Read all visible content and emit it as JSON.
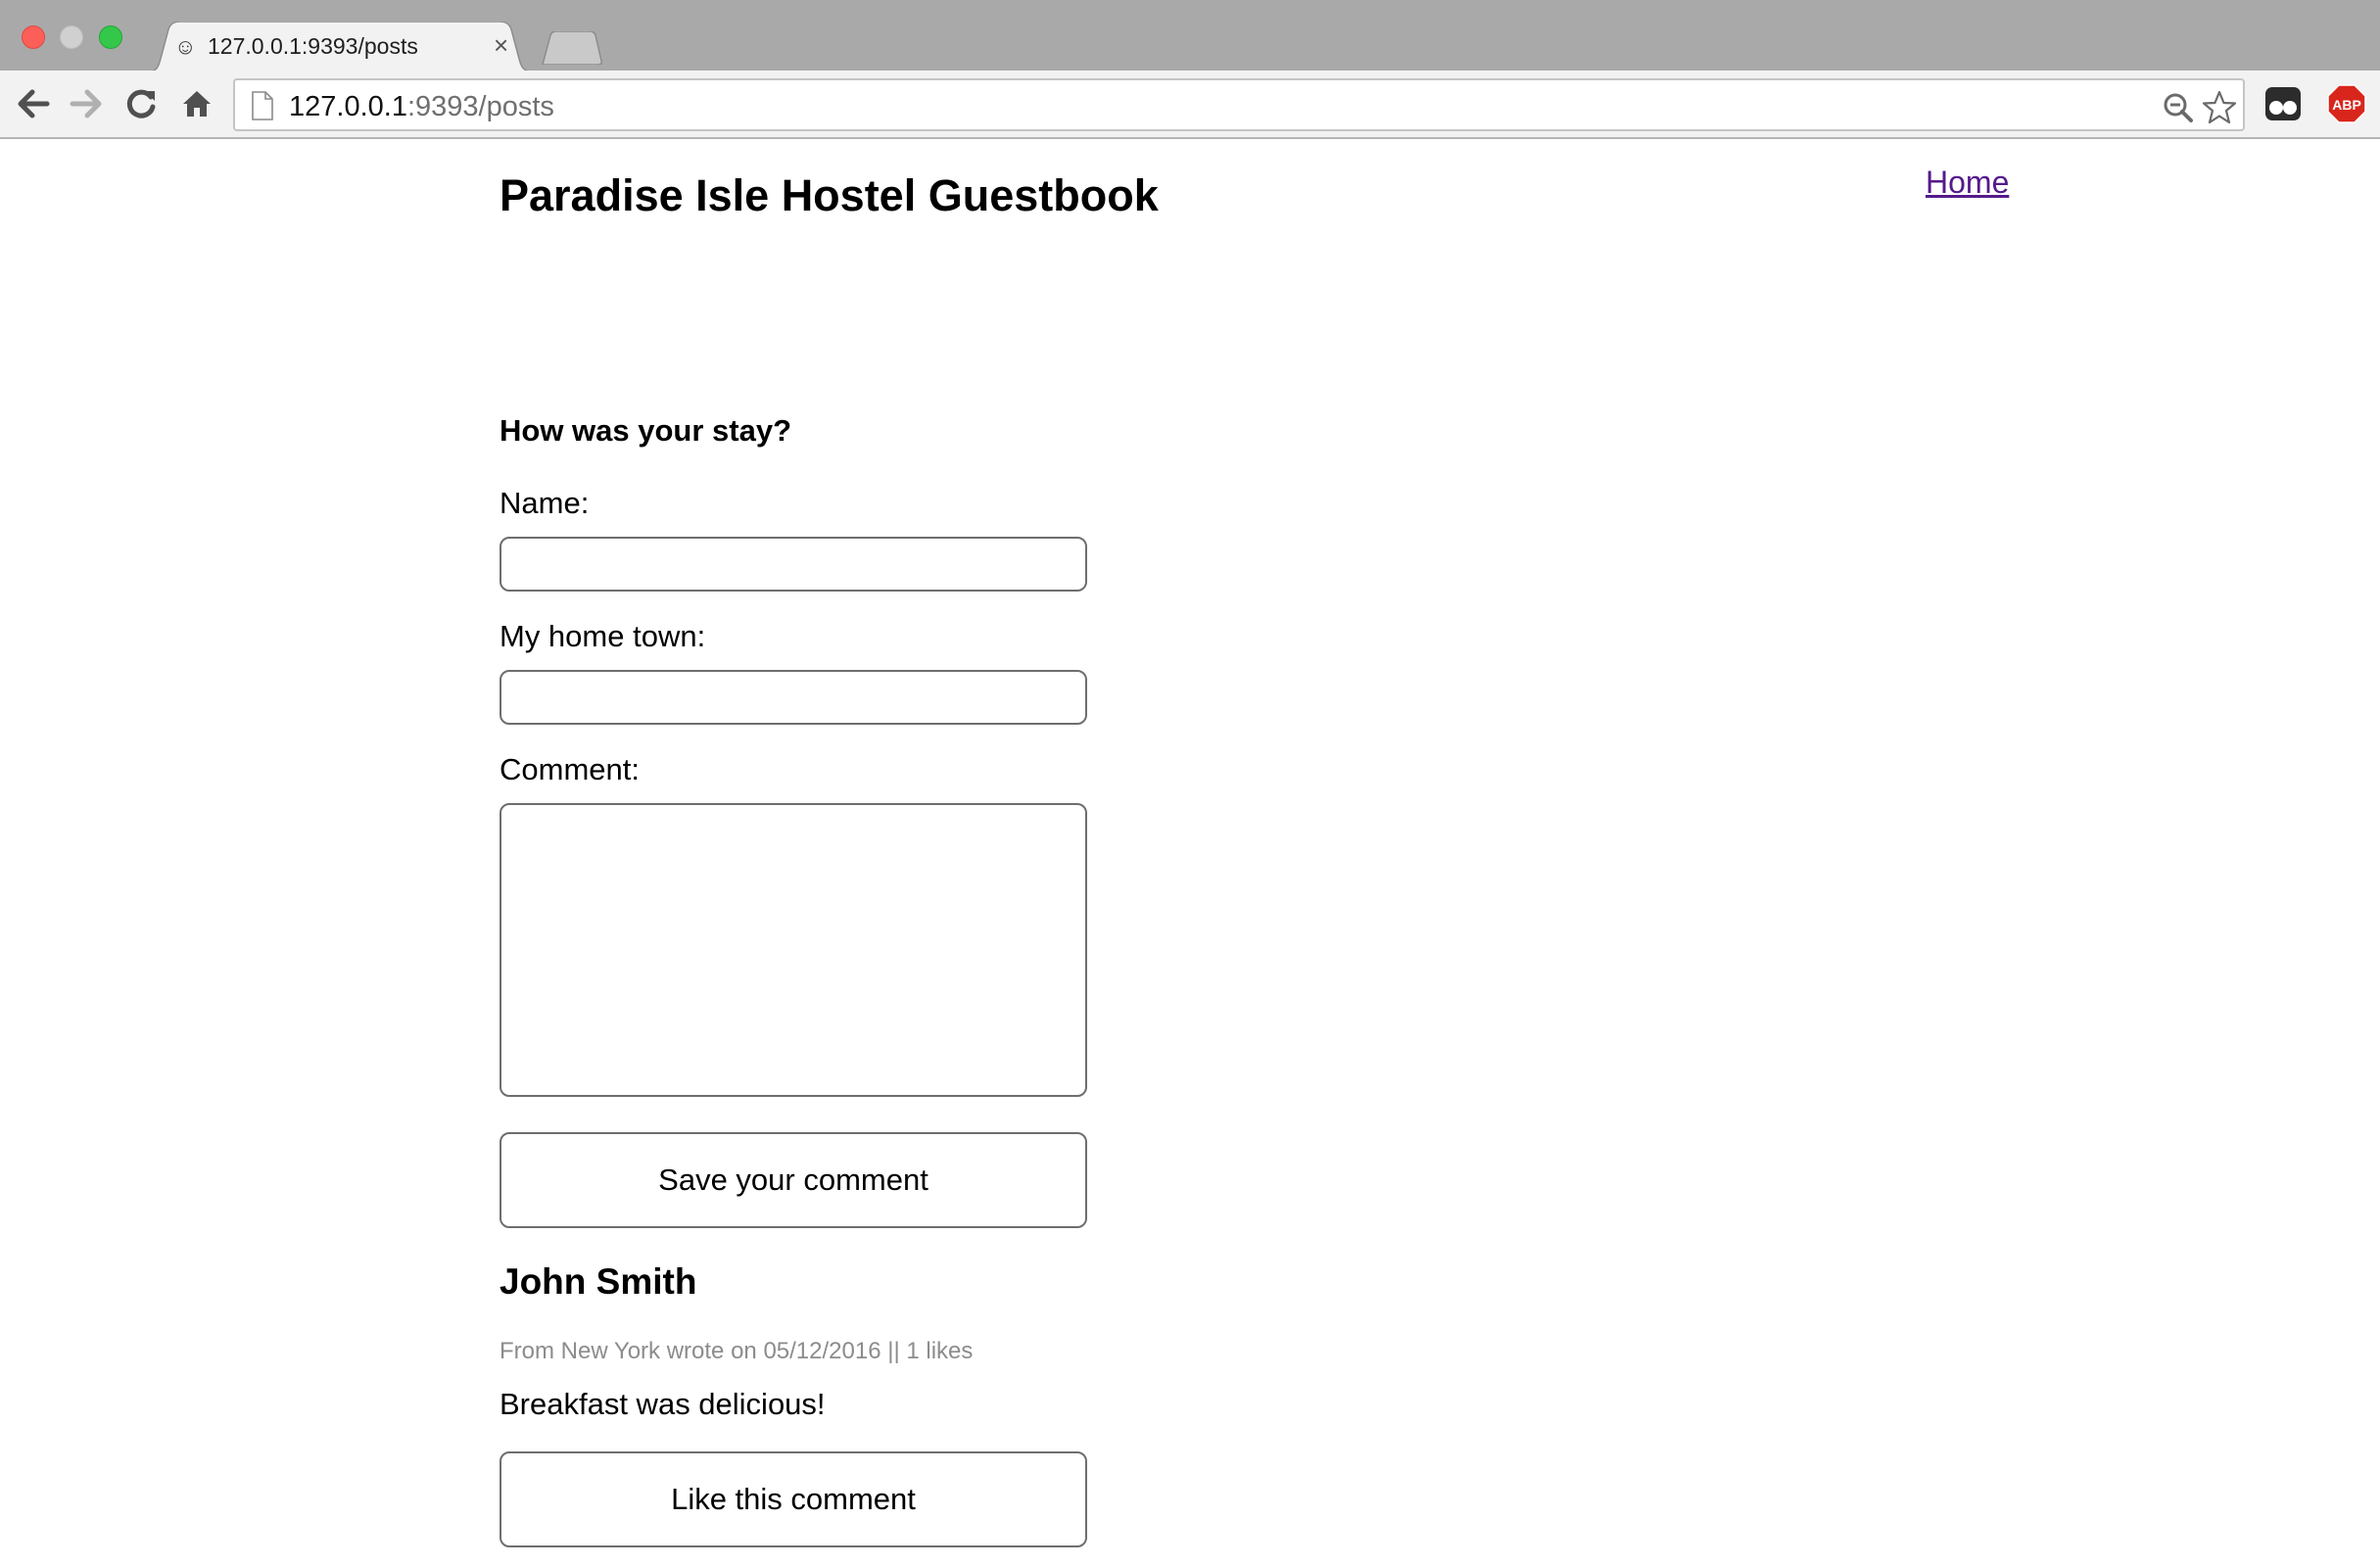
{
  "browser": {
    "tab": {
      "title": "127.0.0.1:9393/posts",
      "favicon": "smiley-favicon-icon",
      "close_glyph": "×"
    },
    "address_bar": {
      "host": "127.0.0.1",
      "path": ":9393/posts"
    },
    "extensions": [
      "ghostery-icon",
      "adblock-plus-icon"
    ],
    "abp_label": "ABP",
    "colors": {
      "abp_red": "#d9261c",
      "link_visited": "#551a8b"
    }
  },
  "page": {
    "title": "Paradise Isle Hostel Guestbook",
    "nav": {
      "home_label": "Home"
    },
    "form": {
      "heading": "How was your stay?",
      "name_label": "Name:",
      "name_value": "",
      "hometown_label": "My home town:",
      "hometown_value": "",
      "comment_label": "Comment:",
      "comment_value": "",
      "submit_label": "Save your comment"
    },
    "posts": [
      {
        "author": "John Smith",
        "meta": "From New York wrote on 05/12/2016 || 1 likes",
        "body": "Breakfast was delicious!",
        "like_label": "Like this comment"
      }
    ]
  }
}
